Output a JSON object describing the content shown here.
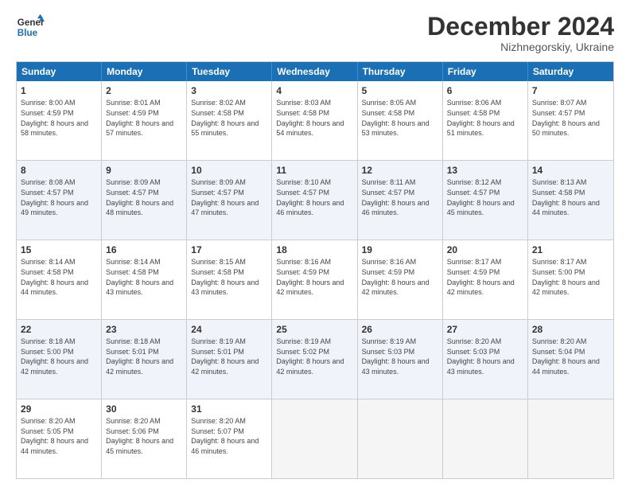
{
  "header": {
    "logo_line1": "General",
    "logo_line2": "Blue",
    "month": "December 2024",
    "location": "Nizhnegorskiy, Ukraine"
  },
  "weekdays": [
    "Sunday",
    "Monday",
    "Tuesday",
    "Wednesday",
    "Thursday",
    "Friday",
    "Saturday"
  ],
  "rows": [
    [
      {
        "day": "1",
        "sunrise": "Sunrise: 8:00 AM",
        "sunset": "Sunset: 4:59 PM",
        "daylight": "Daylight: 8 hours and 58 minutes."
      },
      {
        "day": "2",
        "sunrise": "Sunrise: 8:01 AM",
        "sunset": "Sunset: 4:59 PM",
        "daylight": "Daylight: 8 hours and 57 minutes."
      },
      {
        "day": "3",
        "sunrise": "Sunrise: 8:02 AM",
        "sunset": "Sunset: 4:58 PM",
        "daylight": "Daylight: 8 hours and 55 minutes."
      },
      {
        "day": "4",
        "sunrise": "Sunrise: 8:03 AM",
        "sunset": "Sunset: 4:58 PM",
        "daylight": "Daylight: 8 hours and 54 minutes."
      },
      {
        "day": "5",
        "sunrise": "Sunrise: 8:05 AM",
        "sunset": "Sunset: 4:58 PM",
        "daylight": "Daylight: 8 hours and 53 minutes."
      },
      {
        "day": "6",
        "sunrise": "Sunrise: 8:06 AM",
        "sunset": "Sunset: 4:58 PM",
        "daylight": "Daylight: 8 hours and 51 minutes."
      },
      {
        "day": "7",
        "sunrise": "Sunrise: 8:07 AM",
        "sunset": "Sunset: 4:57 PM",
        "daylight": "Daylight: 8 hours and 50 minutes."
      }
    ],
    [
      {
        "day": "8",
        "sunrise": "Sunrise: 8:08 AM",
        "sunset": "Sunset: 4:57 PM",
        "daylight": "Daylight: 8 hours and 49 minutes."
      },
      {
        "day": "9",
        "sunrise": "Sunrise: 8:09 AM",
        "sunset": "Sunset: 4:57 PM",
        "daylight": "Daylight: 8 hours and 48 minutes."
      },
      {
        "day": "10",
        "sunrise": "Sunrise: 8:09 AM",
        "sunset": "Sunset: 4:57 PM",
        "daylight": "Daylight: 8 hours and 47 minutes."
      },
      {
        "day": "11",
        "sunrise": "Sunrise: 8:10 AM",
        "sunset": "Sunset: 4:57 PM",
        "daylight": "Daylight: 8 hours and 46 minutes."
      },
      {
        "day": "12",
        "sunrise": "Sunrise: 8:11 AM",
        "sunset": "Sunset: 4:57 PM",
        "daylight": "Daylight: 8 hours and 46 minutes."
      },
      {
        "day": "13",
        "sunrise": "Sunrise: 8:12 AM",
        "sunset": "Sunset: 4:57 PM",
        "daylight": "Daylight: 8 hours and 45 minutes."
      },
      {
        "day": "14",
        "sunrise": "Sunrise: 8:13 AM",
        "sunset": "Sunset: 4:58 PM",
        "daylight": "Daylight: 8 hours and 44 minutes."
      }
    ],
    [
      {
        "day": "15",
        "sunrise": "Sunrise: 8:14 AM",
        "sunset": "Sunset: 4:58 PM",
        "daylight": "Daylight: 8 hours and 44 minutes."
      },
      {
        "day": "16",
        "sunrise": "Sunrise: 8:14 AM",
        "sunset": "Sunset: 4:58 PM",
        "daylight": "Daylight: 8 hours and 43 minutes."
      },
      {
        "day": "17",
        "sunrise": "Sunrise: 8:15 AM",
        "sunset": "Sunset: 4:58 PM",
        "daylight": "Daylight: 8 hours and 43 minutes."
      },
      {
        "day": "18",
        "sunrise": "Sunrise: 8:16 AM",
        "sunset": "Sunset: 4:59 PM",
        "daylight": "Daylight: 8 hours and 42 minutes."
      },
      {
        "day": "19",
        "sunrise": "Sunrise: 8:16 AM",
        "sunset": "Sunset: 4:59 PM",
        "daylight": "Daylight: 8 hours and 42 minutes."
      },
      {
        "day": "20",
        "sunrise": "Sunrise: 8:17 AM",
        "sunset": "Sunset: 4:59 PM",
        "daylight": "Daylight: 8 hours and 42 minutes."
      },
      {
        "day": "21",
        "sunrise": "Sunrise: 8:17 AM",
        "sunset": "Sunset: 5:00 PM",
        "daylight": "Daylight: 8 hours and 42 minutes."
      }
    ],
    [
      {
        "day": "22",
        "sunrise": "Sunrise: 8:18 AM",
        "sunset": "Sunset: 5:00 PM",
        "daylight": "Daylight: 8 hours and 42 minutes."
      },
      {
        "day": "23",
        "sunrise": "Sunrise: 8:18 AM",
        "sunset": "Sunset: 5:01 PM",
        "daylight": "Daylight: 8 hours and 42 minutes."
      },
      {
        "day": "24",
        "sunrise": "Sunrise: 8:19 AM",
        "sunset": "Sunset: 5:01 PM",
        "daylight": "Daylight: 8 hours and 42 minutes."
      },
      {
        "day": "25",
        "sunrise": "Sunrise: 8:19 AM",
        "sunset": "Sunset: 5:02 PM",
        "daylight": "Daylight: 8 hours and 42 minutes."
      },
      {
        "day": "26",
        "sunrise": "Sunrise: 8:19 AM",
        "sunset": "Sunset: 5:03 PM",
        "daylight": "Daylight: 8 hours and 43 minutes."
      },
      {
        "day": "27",
        "sunrise": "Sunrise: 8:20 AM",
        "sunset": "Sunset: 5:03 PM",
        "daylight": "Daylight: 8 hours and 43 minutes."
      },
      {
        "day": "28",
        "sunrise": "Sunrise: 8:20 AM",
        "sunset": "Sunset: 5:04 PM",
        "daylight": "Daylight: 8 hours and 44 minutes."
      }
    ],
    [
      {
        "day": "29",
        "sunrise": "Sunrise: 8:20 AM",
        "sunset": "Sunset: 5:05 PM",
        "daylight": "Daylight: 8 hours and 44 minutes."
      },
      {
        "day": "30",
        "sunrise": "Sunrise: 8:20 AM",
        "sunset": "Sunset: 5:06 PM",
        "daylight": "Daylight: 8 hours and 45 minutes."
      },
      {
        "day": "31",
        "sunrise": "Sunrise: 8:20 AM",
        "sunset": "Sunset: 5:07 PM",
        "daylight": "Daylight: 8 hours and 46 minutes."
      },
      null,
      null,
      null,
      null
    ]
  ]
}
